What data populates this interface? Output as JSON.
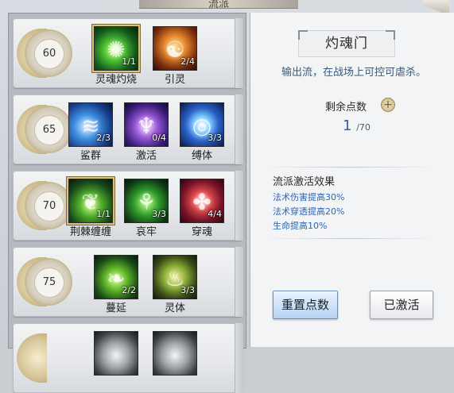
{
  "header": {
    "title": "流派"
  },
  "tiers": [
    {
      "level": "60",
      "skills": [
        {
          "name": "灵魂灼烧",
          "count": "1/1",
          "selected": true
        },
        {
          "name": "引灵",
          "count": "2/4",
          "selected": false
        }
      ]
    },
    {
      "level": "65",
      "skills": [
        {
          "name": "鲨群",
          "count": "2/3",
          "selected": false
        },
        {
          "name": "激活",
          "count": "0/4",
          "selected": false
        },
        {
          "name": "缚体",
          "count": "3/3",
          "selected": false
        }
      ]
    },
    {
      "level": "70",
      "skills": [
        {
          "name": "荆棘缠缠",
          "count": "1/1",
          "selected": true
        },
        {
          "name": "哀牢",
          "count": "3/3",
          "selected": false
        },
        {
          "name": "穿魂",
          "count": "4/4",
          "selected": false
        }
      ]
    },
    {
      "level": "75",
      "skills": [
        {
          "name": "蔓延",
          "count": "2/2",
          "selected": false
        },
        {
          "name": "灵体",
          "count": "3/3",
          "selected": false
        }
      ]
    }
  ],
  "panel": {
    "school_name": "灼魂门",
    "description": "输出流，在战场上可控可虐杀。",
    "remaining_label": "剩余点数",
    "remaining_points": "1",
    "total_points": "/70",
    "effects_title": "流派激活效果",
    "effects": [
      "法术伤害提高30%",
      "法术穿透提高20%",
      "生命提高10%"
    ],
    "reset_label": "重置点数",
    "activated_label": "已激活"
  },
  "icons": {
    "plus": "plus-icon",
    "tier_medal": "laurel-medal-icon"
  },
  "colors": {
    "accent_blue": "#2d62a3",
    "effect_blue": "#2a66b8",
    "desc_blue": "#3b5a7a"
  }
}
